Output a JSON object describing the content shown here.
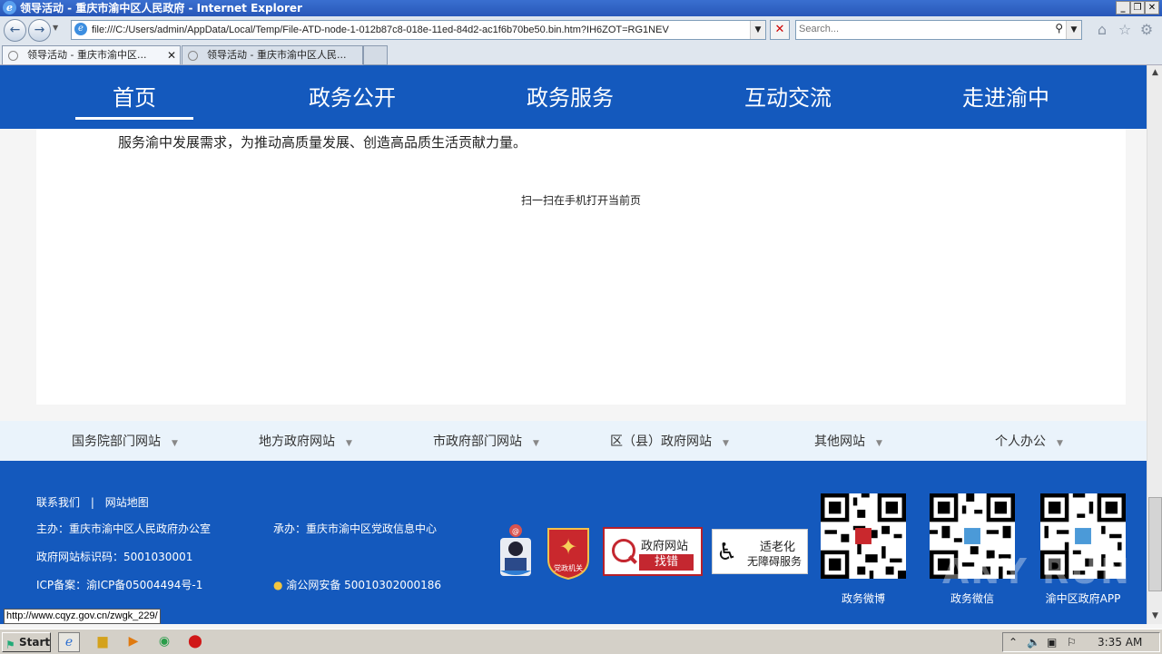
{
  "window": {
    "title": "领导活动 - 重庆市渝中区人民政府 - Internet Explorer",
    "minimize": "_",
    "restore": "❐",
    "close": "✕"
  },
  "addressbar": {
    "url": "file:///C:/Users/admin/AppData/Local/Temp/File-ATD-node-1-012b87c8-018e-11ed-84d2-ac1f6b70be50.bin.htm?IH6ZOT=RG1NEV",
    "search_placeholder": "Search..."
  },
  "tabs": [
    {
      "label": "领导活动 - 重庆市渝中区..."
    },
    {
      "label": "领导活动 - 重庆市渝中区人民..."
    }
  ],
  "nav": {
    "items": [
      "首页",
      "政务公开",
      "政务服务",
      "互动交流",
      "走进渝中"
    ]
  },
  "content": {
    "body_text": "服务渝中发展需求，为推动高质量发展、创造高品质生活贡献力量。",
    "qr_hint": "扫一扫在手机打开当前页"
  },
  "links": [
    "国务院部门网站",
    "地方政府网站",
    "市政府部门网站",
    "区（县）政府网站",
    "其他网站",
    "个人办公"
  ],
  "footer": {
    "contact": "联系我们",
    "sep": "|",
    "sitemap": "网站地图",
    "host": "主办：重庆市渝中区人民政府办公室",
    "organizer": "承办：重庆市渝中区党政信息中心",
    "site_id": "政府网站标识码：5001030001",
    "icp": "ICP备案：渝ICP备05004494号-1",
    "police": "渝公网安备 50010302000186",
    "badge2_text": "党政机关",
    "report_btn_top": "政府网站",
    "report_btn_bottom": "找错",
    "access_top": "适老化",
    "access_bottom": "无障碍服务",
    "qr_labels": [
      "政务微博",
      "政务微信",
      "渝中区政府APP"
    ]
  },
  "status_url": "http://www.cqyz.gov.cn/zwgk_229/",
  "watermark": "ANY RUN",
  "taskbar": {
    "start": "Start",
    "clock": "3:35 AM"
  },
  "colors": {
    "brand_blue": "#1459bd",
    "links_bg": "#eaf3fb",
    "accent_red": "#c42730"
  }
}
